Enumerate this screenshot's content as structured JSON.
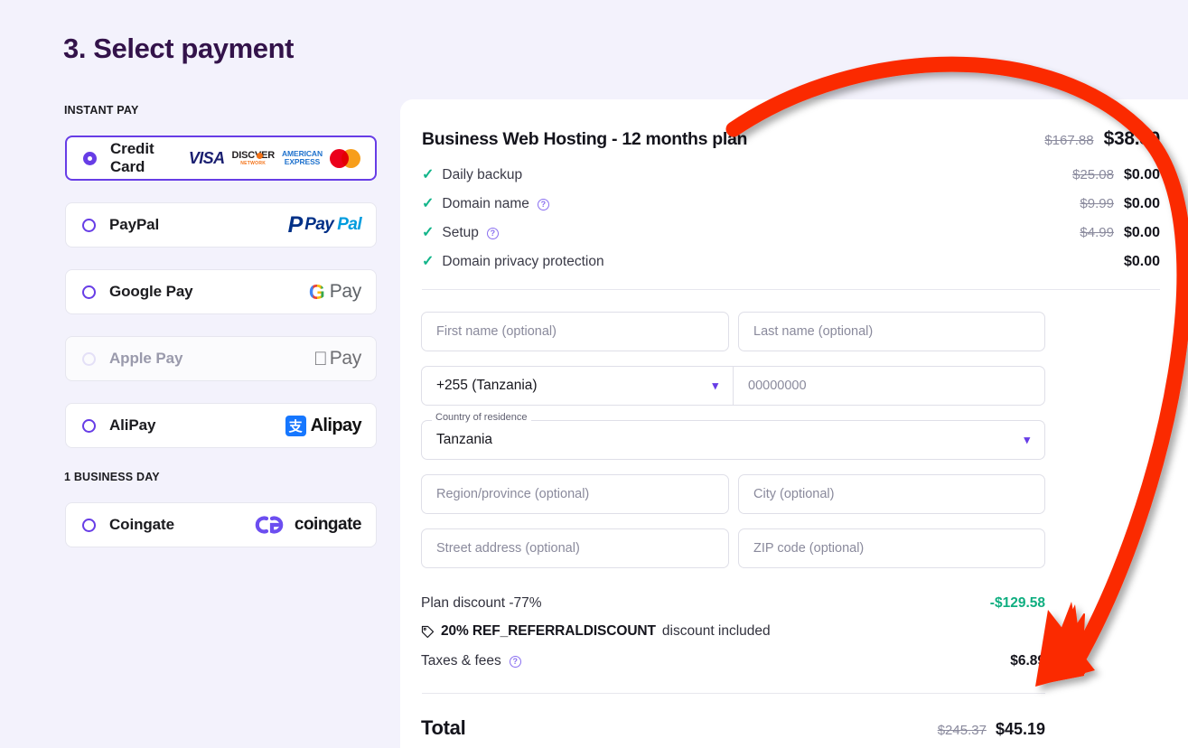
{
  "page": {
    "title": "3. Select payment",
    "background_color": "#f3f2fc",
    "accent_color": "#673de6"
  },
  "payment_methods": {
    "groups": [
      {
        "label": "INSTANT PAY",
        "items": [
          {
            "name": "Credit Card",
            "selected": true,
            "disabled": false,
            "brand": "cards"
          },
          {
            "name": "PayPal",
            "selected": false,
            "disabled": false,
            "brand": "paypal"
          },
          {
            "name": "Google Pay",
            "selected": false,
            "disabled": false,
            "brand": "googlepay"
          },
          {
            "name": "Apple Pay",
            "selected": false,
            "disabled": true,
            "brand": "applepay"
          },
          {
            "name": "AliPay",
            "selected": false,
            "disabled": false,
            "brand": "alipay"
          }
        ]
      },
      {
        "label": "1 BUSINESS DAY",
        "items": [
          {
            "name": "Coingate",
            "selected": false,
            "disabled": false,
            "brand": "coingate"
          }
        ]
      }
    ],
    "card_brands": {
      "visa": "VISA",
      "discover_top": "DISCVER",
      "discover_bottom": "NETWORK",
      "amex_line1": "AMERICAN",
      "amex_line2": "EXPRESS",
      "mastercard": "mastercard-icon"
    },
    "paypal": {
      "pay": "Pay",
      "pal": "Pal"
    },
    "googlepay": {
      "g": "G",
      "pay": "Pay"
    },
    "applepay": {
      "logo": "",
      "pay": "Pay"
    },
    "alipay": {
      "mark": "支",
      "text": "Alipay"
    },
    "coingate": {
      "text": "coingate"
    }
  },
  "summary": {
    "plan": {
      "title": "Business Web Hosting - 12 months plan",
      "old_price": "$167.88",
      "new_price": "$38.30"
    },
    "features": [
      {
        "label": "Daily backup",
        "old_price": "$25.08",
        "new_price": "$0.00",
        "has_help": false
      },
      {
        "label": "Domain name",
        "old_price": "$9.99",
        "new_price": "$0.00",
        "has_help": true
      },
      {
        "label": "Setup",
        "old_price": "$4.99",
        "new_price": "$0.00",
        "has_help": true
      },
      {
        "label": "Domain privacy protection",
        "old_price": "",
        "new_price": "$0.00",
        "has_help": false
      }
    ],
    "form": {
      "first_name_placeholder": "First name (optional)",
      "last_name_placeholder": "Last name (optional)",
      "phone_code_value": "+255 (Tanzania)",
      "phone_number_placeholder": "00000000",
      "country_legend": "Country of residence",
      "country_value": "Tanzania",
      "region_placeholder": "Region/province (optional)",
      "city_placeholder": "City (optional)",
      "street_placeholder": "Street address (optional)",
      "zip_placeholder": "ZIP code (optional)"
    },
    "discount": {
      "plan_discount_label": "Plan discount -77%",
      "plan_discount_amount": "-$129.58",
      "promo_strong": "20% REF_REFERRALDISCOUNT",
      "promo_rest": "discount included",
      "taxes_label": "Taxes & fees",
      "taxes_amount": "$6.89"
    },
    "total": {
      "label": "Total",
      "old_price": "$245.37",
      "new_price": "$45.19"
    }
  },
  "annotation": {
    "type": "curved-arrow",
    "color": "#fb2c05",
    "points_to": "Total price $45.19"
  }
}
